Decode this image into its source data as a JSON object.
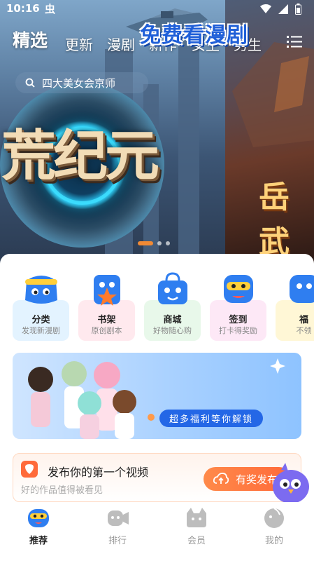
{
  "status": {
    "time": "10:16",
    "notif_glyph": "虫"
  },
  "tabs": [
    {
      "label": "精选",
      "active": true
    },
    {
      "label": "更新"
    },
    {
      "label": "漫剧"
    },
    {
      "label": "新作"
    },
    {
      "label": "女生"
    },
    {
      "label": "男生"
    }
  ],
  "search": {
    "placeholder": "四大美女会京师"
  },
  "banner": {
    "title_art": "荒纪元",
    "side_art": "岳武",
    "page_count": 3,
    "active_index": 0
  },
  "categories": [
    {
      "label": "分类",
      "sub": "发现新漫剧",
      "bg": "#e3f3ff",
      "icon": "category-icon"
    },
    {
      "label": "书架",
      "sub": "原创剧本",
      "bg": "#ffe9ee",
      "icon": "bookshelf-icon"
    },
    {
      "label": "商城",
      "sub": "好物随心购",
      "bg": "#e8f8ea",
      "icon": "shop-icon"
    },
    {
      "label": "签到",
      "sub": "打卡得奖励",
      "bg": "#fde8f6",
      "icon": "checkin-icon"
    },
    {
      "label": "福",
      "sub": "不领",
      "bg": "#fff7d6",
      "icon": "welfare-icon"
    }
  ],
  "promo": {
    "title": "免费看漫剧",
    "subtitle": "超多福利等你解锁"
  },
  "post": {
    "title": "发布你的第一个视频",
    "subtitle": "好的作品值得被看见",
    "button": "有奖发布"
  },
  "nav": [
    {
      "label": "推荐",
      "active": true,
      "icon": "recommend-icon"
    },
    {
      "label": "排行",
      "icon": "ranking-icon"
    },
    {
      "label": "会员",
      "icon": "member-icon"
    },
    {
      "label": "我的",
      "icon": "profile-icon"
    }
  ],
  "colors": {
    "accent": "#ff6a3a",
    "promo_blue": "#1f5fd8",
    "active_dot": "#f08a35"
  }
}
